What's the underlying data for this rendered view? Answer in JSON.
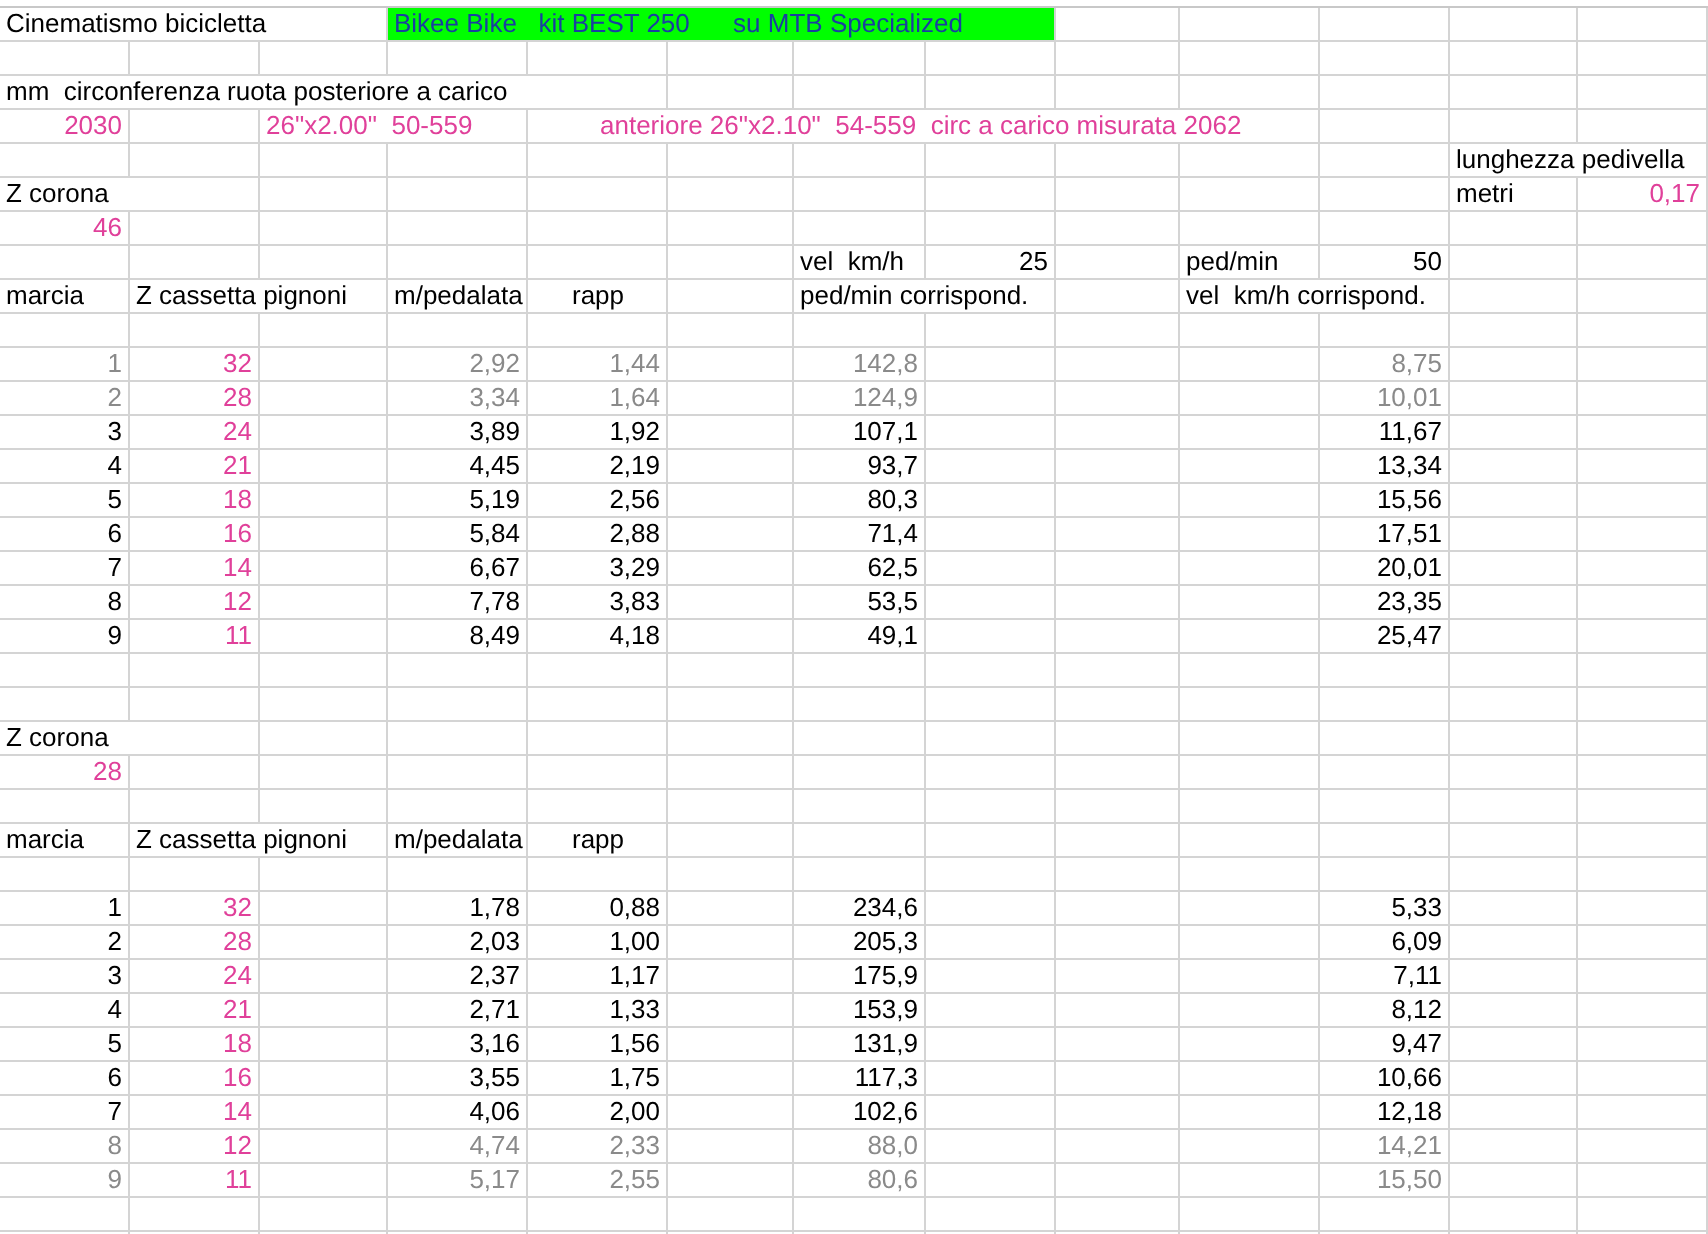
{
  "title": "Cinematismo bicicletta",
  "banner": "Bikee Bike   kit BEST 250      su MTB Specialized",
  "circumference_label": "mm  circonferenza ruota posteriore a carico",
  "circumference": "2030",
  "rear_tire": "26\"x2.00\"  50-559",
  "front_tire_note": "anteriore 26\"x2.10\"  54-559  circ a carico misurata 2062",
  "crank": {
    "label": "lunghezza pedivella",
    "unit": "metri",
    "value": "0,17"
  },
  "speed_input": {
    "label": "vel  km/h",
    "value": "25"
  },
  "cadence_input": {
    "label": "ped/min",
    "value": "50"
  },
  "sections": [
    {
      "label": "Z corona",
      "value": "46",
      "columns": [
        "marcia",
        "Z cassetta pignoni",
        "m/pedalata",
        "rapp",
        "ped/min corrispond.",
        "vel  km/h corrispond."
      ],
      "rows": [
        {
          "gear": "1",
          "cogs": "32",
          "m": "2,92",
          "rapp": "1,44",
          "cadence": "142,8",
          "speed": "8,75",
          "dimmed": true
        },
        {
          "gear": "2",
          "cogs": "28",
          "m": "3,34",
          "rapp": "1,64",
          "cadence": "124,9",
          "speed": "10,01",
          "dimmed": true
        },
        {
          "gear": "3",
          "cogs": "24",
          "m": "3,89",
          "rapp": "1,92",
          "cadence": "107,1",
          "speed": "11,67",
          "dimmed": false
        },
        {
          "gear": "4",
          "cogs": "21",
          "m": "4,45",
          "rapp": "2,19",
          "cadence": "93,7",
          "speed": "13,34",
          "dimmed": false
        },
        {
          "gear": "5",
          "cogs": "18",
          "m": "5,19",
          "rapp": "2,56",
          "cadence": "80,3",
          "speed": "15,56",
          "dimmed": false
        },
        {
          "gear": "6",
          "cogs": "16",
          "m": "5,84",
          "rapp": "2,88",
          "cadence": "71,4",
          "speed": "17,51",
          "dimmed": false
        },
        {
          "gear": "7",
          "cogs": "14",
          "m": "6,67",
          "rapp": "3,29",
          "cadence": "62,5",
          "speed": "20,01",
          "dimmed": false
        },
        {
          "gear": "8",
          "cogs": "12",
          "m": "7,78",
          "rapp": "3,83",
          "cadence": "53,5",
          "speed": "23,35",
          "dimmed": false
        },
        {
          "gear": "9",
          "cogs": "11",
          "m": "8,49",
          "rapp": "4,18",
          "cadence": "49,1",
          "speed": "25,47",
          "dimmed": false
        }
      ]
    },
    {
      "label": "Z corona",
      "value": "28",
      "columns": [
        "marcia",
        "Z cassetta pignoni",
        "m/pedalata",
        "rapp"
      ],
      "rows": [
        {
          "gear": "1",
          "cogs": "32",
          "m": "1,78",
          "rapp": "0,88",
          "cadence": "234,6",
          "speed": "5,33",
          "dimmed": false
        },
        {
          "gear": "2",
          "cogs": "28",
          "m": "2,03",
          "rapp": "1,00",
          "cadence": "205,3",
          "speed": "6,09",
          "dimmed": false
        },
        {
          "gear": "3",
          "cogs": "24",
          "m": "2,37",
          "rapp": "1,17",
          "cadence": "175,9",
          "speed": "7,11",
          "dimmed": false
        },
        {
          "gear": "4",
          "cogs": "21",
          "m": "2,71",
          "rapp": "1,33",
          "cadence": "153,9",
          "speed": "8,12",
          "dimmed": false
        },
        {
          "gear": "5",
          "cogs": "18",
          "m": "3,16",
          "rapp": "1,56",
          "cadence": "131,9",
          "speed": "9,47",
          "dimmed": false
        },
        {
          "gear": "6",
          "cogs": "16",
          "m": "3,55",
          "rapp": "1,75",
          "cadence": "117,3",
          "speed": "10,66",
          "dimmed": false
        },
        {
          "gear": "7",
          "cogs": "14",
          "m": "4,06",
          "rapp": "2,00",
          "cadence": "102,6",
          "speed": "12,18",
          "dimmed": false
        },
        {
          "gear": "8",
          "cogs": "12",
          "m": "4,74",
          "rapp": "2,33",
          "cadence": "88,0",
          "speed": "14,21",
          "dimmed": true
        },
        {
          "gear": "9",
          "cogs": "11",
          "m": "5,17",
          "rapp": "2,55",
          "cadence": "80,6",
          "speed": "15,50",
          "dimmed": true
        }
      ]
    }
  ]
}
